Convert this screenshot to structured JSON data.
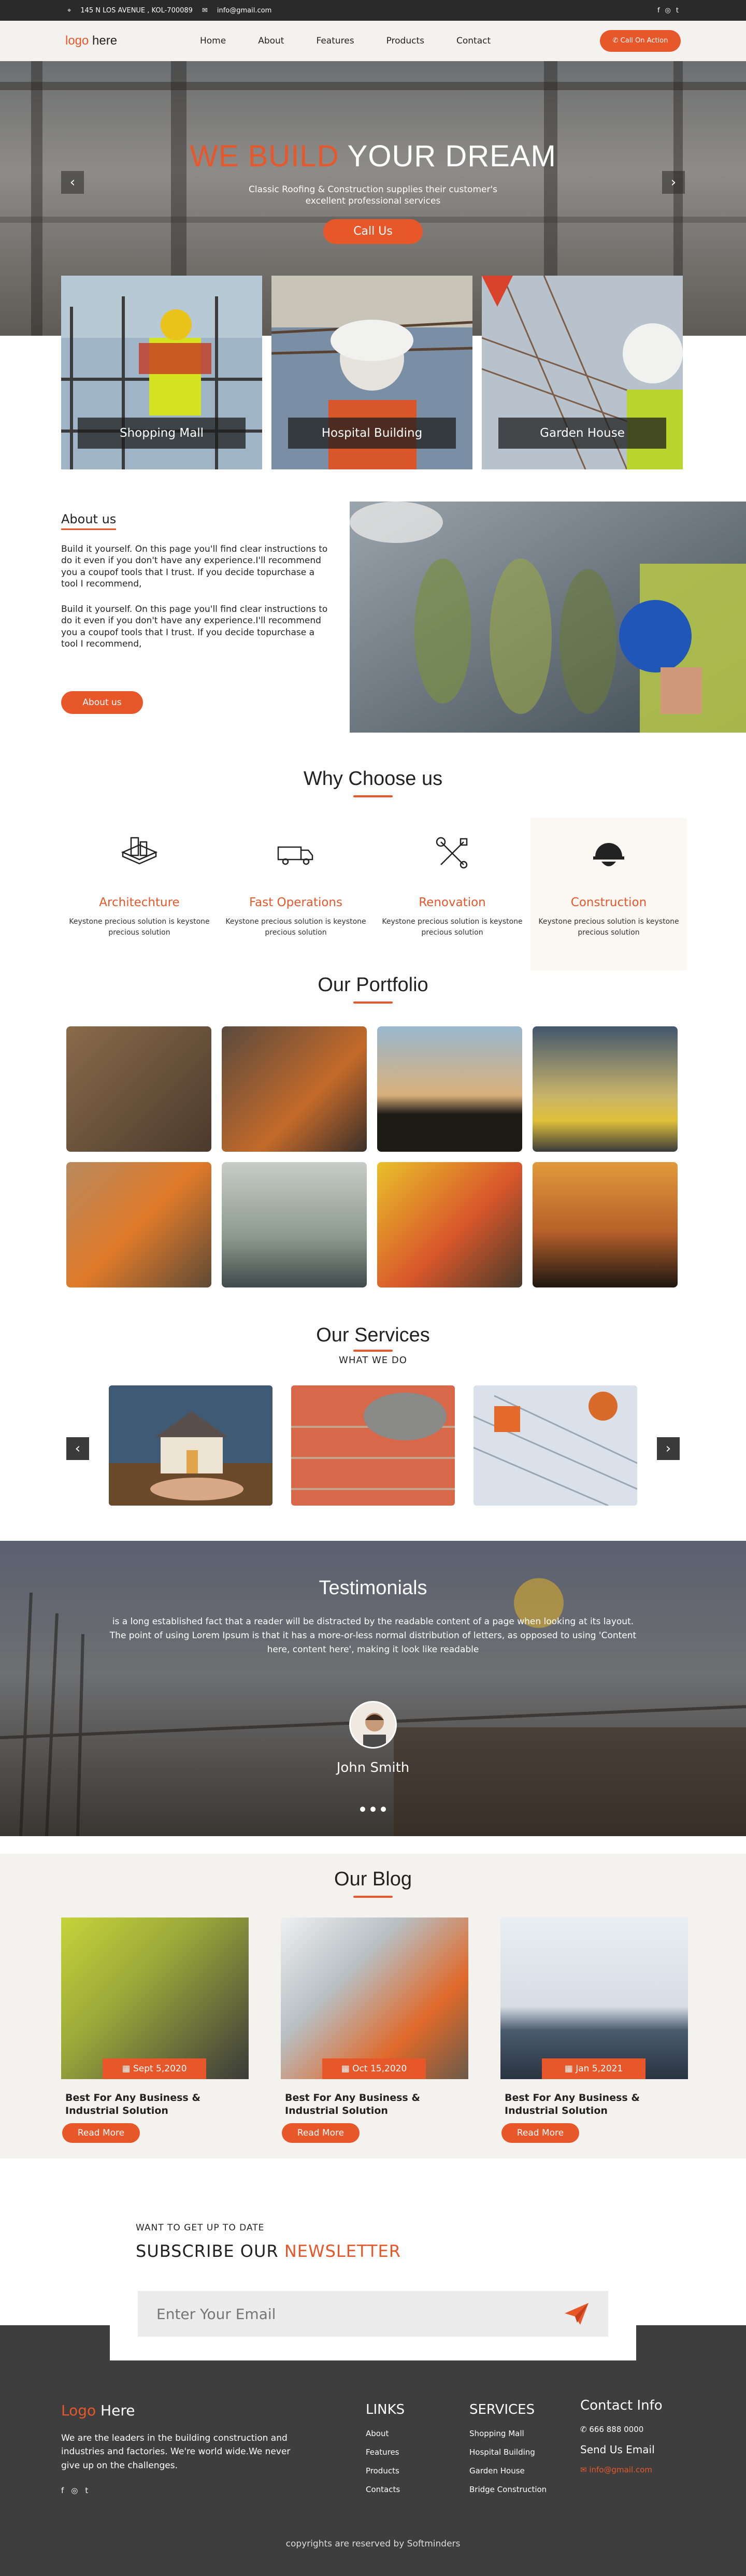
{
  "topbar": {
    "address": "145 N LOS AVENUE , KOL-700089",
    "email": "info@gmail.com",
    "social": [
      "f",
      "◎",
      "t"
    ]
  },
  "nav": {
    "logo_a": "logo",
    "logo_b": " here",
    "links": [
      "Home",
      "About",
      "Features",
      "Products",
      "Contact"
    ],
    "cta": "Call On Action"
  },
  "hero": {
    "title_a": "WE BUILD ",
    "title_b": "YOUR DREAM",
    "subtitle": "Classic Roofing & Construction supplies their customer's excellent professional services",
    "button": "Call Us",
    "prev": "‹",
    "next": "›"
  },
  "projects": [
    "Shopping Mall",
    "Hospital Building",
    "Garden House"
  ],
  "about": {
    "heading": "About us",
    "para1": "Build it yourself. On this page you'll find clear instructions to do it even if you don't have any experience.I'll recommend you a coupof tools that I trust. If you decide topurchase a tool I recommend,",
    "para2": "Build it yourself. On this page you'll find clear instructions to do it even if you don't have any experience.I'll recommend you a coupof tools that I trust. If you decide topurchase a tool I recommend,",
    "button": "About us"
  },
  "why": {
    "title": "Why Choose us",
    "features": [
      {
        "icon": "building-icon",
        "title": "Architechture",
        "text": "Keystone precious solution is keystone precious solution"
      },
      {
        "icon": "truck-icon",
        "title": "Fast Operations",
        "text": "Keystone precious solution is keystone precious solution"
      },
      {
        "icon": "tools-icon",
        "title": "Renovation",
        "text": "Keystone precious solution is keystone precious solution"
      },
      {
        "icon": "helmet-icon",
        "title": "Construction",
        "text": "Keystone precious solution is keystone precious solution"
      }
    ]
  },
  "portfolio": {
    "title": "Our Portfolio"
  },
  "services": {
    "title": "Our Services",
    "subtitle": "WHAT WE DO"
  },
  "testimonials": {
    "title": "Testimonials",
    "quote": "is a long established fact that a reader will be distracted by the readable content of a page when looking at its layout. The point of using Lorem Ipsum is that it has a more-or-less normal distribution of letters, as opposed to using 'Content here, content here', making it look like readable",
    "name": "John Smith"
  },
  "blog": {
    "title": "Our Blog",
    "posts": [
      {
        "date": "Sept 5,2020",
        "title": "Best For Any Business & Industrial Solution",
        "button": "Read More"
      },
      {
        "date": "Oct 15,2020",
        "title": "Best For Any Business & Industrial Solution",
        "button": "Read More"
      },
      {
        "date": "Jan 5,2021",
        "title": "Best For Any Business & Industrial Solution",
        "button": "Read More"
      }
    ]
  },
  "newsletter": {
    "small": "WANT TO GET UP TO DATE",
    "title_a": "SUBSCRIBE OUR ",
    "title_b": "NEWSLETTER",
    "placeholder": "Enter Your Email"
  },
  "footer": {
    "logo_a": "Logo",
    "logo_b": " Here",
    "about": "We are the leaders in the building construction and industries and factories. We're world wide.We never give up on the challenges.",
    "links_title": "LINKS",
    "links": [
      "About",
      "Features",
      "Products",
      "Contacts"
    ],
    "services_title": "SERVICES",
    "services": [
      "Shopping Mall",
      "Hospital Building",
      "Garden House",
      "Bridge Construction"
    ],
    "contact_title": "Contact Info",
    "phone": "666 888 0000",
    "send": "Send Us Email",
    "email": "info@gmail.com",
    "copyright": "copyrights are reserved by Softminders"
  },
  "colors": {
    "accent": "#e8572a",
    "dark": "#2a2a2a",
    "footer": "#3e3e3e",
    "light": "#f4f2ee"
  }
}
